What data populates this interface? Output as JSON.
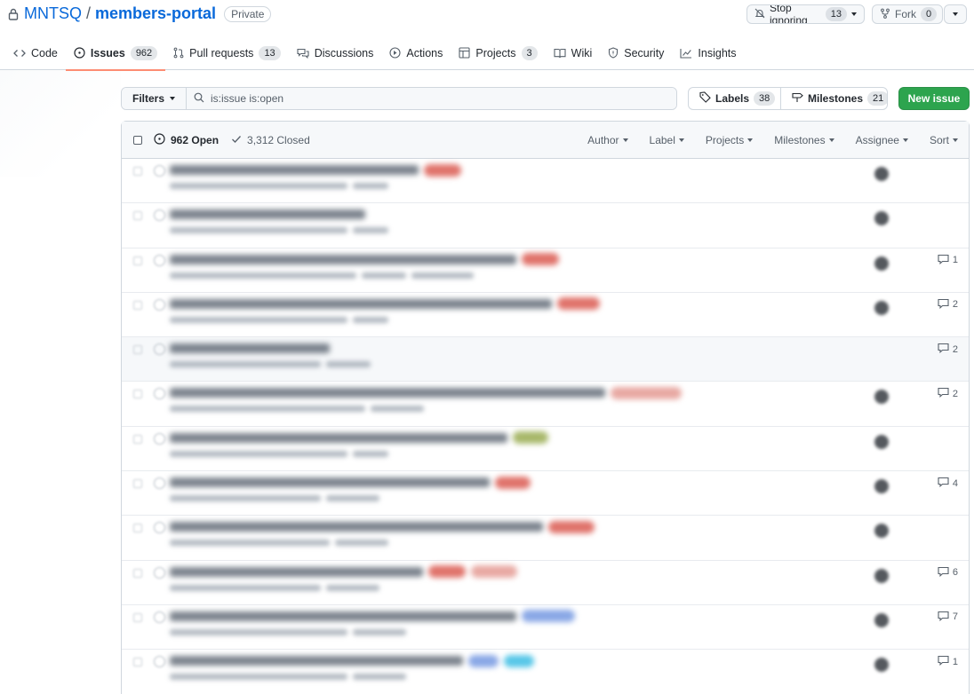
{
  "repo": {
    "owner": "MNTSQ",
    "separator": "/",
    "name": "members-portal",
    "visibility": "Private"
  },
  "header_actions": {
    "watch_label": "Stop ignoring",
    "watch_count": "13",
    "fork_label": "Fork",
    "fork_count": "0"
  },
  "tabs": [
    {
      "label": "Code",
      "icon": "code-icon"
    },
    {
      "label": "Issues",
      "count": "962",
      "icon": "issue-opened-icon",
      "selected": true
    },
    {
      "label": "Pull requests",
      "count": "13",
      "icon": "git-pull-request-icon"
    },
    {
      "label": "Discussions",
      "icon": "comment-discussion-icon"
    },
    {
      "label": "Actions",
      "icon": "play-icon"
    },
    {
      "label": "Projects",
      "count": "3",
      "icon": "table-icon"
    },
    {
      "label": "Wiki",
      "icon": "book-icon"
    },
    {
      "label": "Security",
      "icon": "shield-icon"
    },
    {
      "label": "Insights",
      "icon": "graph-icon"
    }
  ],
  "filters": {
    "button_label": "Filters",
    "query": "is:issue is:open"
  },
  "labels_button": {
    "label": "Labels",
    "count": "38"
  },
  "milestones_button": {
    "label": "Milestones",
    "count": "21"
  },
  "new_issue_label": "New issue",
  "issues_header": {
    "open_label": "962 Open",
    "closed_label": "3,312 Closed",
    "filters": [
      "Author",
      "Label",
      "Projects",
      "Milestones",
      "Assignee",
      "Sort"
    ]
  },
  "issues": [
    {
      "comments": ""
    },
    {
      "comments": ""
    },
    {
      "comments": "1"
    },
    {
      "comments": "2"
    },
    {
      "comments": "2"
    },
    {
      "comments": "2"
    },
    {
      "comments": ""
    },
    {
      "comments": "4"
    },
    {
      "comments": ""
    },
    {
      "comments": "6"
    },
    {
      "comments": "7"
    },
    {
      "comments": "1"
    }
  ],
  "colors": {
    "link": "#0969da",
    "primary_button": "#2da44e",
    "tab_underline": "#fd8c73",
    "label_red": "#e0736b",
    "label_green": "#a8b86a",
    "label_blue": "#8aa8e6",
    "label_cyan": "#58c7e8"
  }
}
